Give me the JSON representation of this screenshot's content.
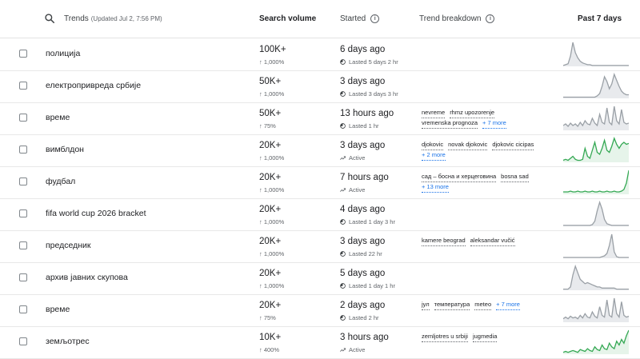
{
  "header": {
    "trends_label": "Trends",
    "updated": "(Updated Jul 2, 7:56 PM)",
    "volume": "Search volume",
    "started": "Started",
    "breakdown": "Trend breakdown",
    "past": "Past 7 days"
  },
  "colors": {
    "gray_line": "#9aa0a6",
    "gray_fill": "#e8eaed",
    "green_line": "#34a853",
    "green_fill": "#e6f4ea",
    "link": "#1a73e8"
  },
  "rows": [
    {
      "title": "полиција",
      "volume": "100K+",
      "pct": "↑ 1,000%",
      "ago": "6 days ago",
      "status": "Lasted 5 days 2 hr",
      "active": false,
      "chips": [],
      "more": "",
      "series": [
        1,
        2,
        3,
        12,
        28,
        16,
        10,
        6,
        4,
        3,
        2,
        2,
        1,
        1,
        1,
        1,
        1,
        1,
        1,
        1,
        1,
        1,
        1,
        1,
        1,
        1,
        1,
        1
      ],
      "green": false
    },
    {
      "title": "електропривреда србије",
      "volume": "50K+",
      "pct": "↑ 1,000%",
      "ago": "3 days ago",
      "status": "Lasted 3 days 3 hr",
      "active": false,
      "chips": [],
      "more": "",
      "series": [
        1,
        1,
        1,
        1,
        1,
        1,
        1,
        1,
        1,
        1,
        1,
        1,
        1,
        1,
        2,
        4,
        10,
        18,
        14,
        8,
        12,
        20,
        15,
        10,
        6,
        4,
        3,
        3
      ],
      "green": false
    },
    {
      "title": "време",
      "volume": "50K+",
      "pct": "↑ 75%",
      "ago": "13 hours ago",
      "status": "Lasted 1 hr",
      "active": false,
      "chips": [
        "nevreme",
        "rhmz upozorenje",
        "vremenska prognoza"
      ],
      "more": "+ 7 more",
      "series": [
        6,
        8,
        5,
        9,
        6,
        8,
        5,
        10,
        6,
        12,
        8,
        7,
        15,
        9,
        6,
        20,
        10,
        8,
        28,
        10,
        7,
        30,
        12,
        8,
        26,
        10,
        8,
        9
      ],
      "green": false
    },
    {
      "title": "вимблдон",
      "volume": "20K+",
      "pct": "↑ 1,000%",
      "ago": "3 days ago",
      "status": "Active",
      "active": true,
      "chips": [
        "djokovic",
        "novak djokovic",
        "djokovic cicipas"
      ],
      "more": "+ 2 more",
      "series": [
        2,
        3,
        2,
        4,
        6,
        3,
        2,
        2,
        3,
        14,
        6,
        4,
        12,
        20,
        10,
        8,
        14,
        22,
        12,
        10,
        16,
        24,
        18,
        14,
        18,
        20,
        18,
        19
      ],
      "green": true
    },
    {
      "title": "фудбал",
      "volume": "20K+",
      "pct": "↑ 1,000%",
      "ago": "7 hours ago",
      "status": "Active",
      "active": true,
      "chips": [
        "сад – босна и херцеговина",
        "bosna sad"
      ],
      "more": "+ 13 more",
      "series": [
        3,
        3,
        3,
        4,
        3,
        3,
        4,
        3,
        3,
        4,
        3,
        3,
        4,
        3,
        3,
        4,
        3,
        3,
        4,
        3,
        3,
        4,
        3,
        3,
        4,
        6,
        14,
        30
      ],
      "green": true
    },
    {
      "title": "fifa world cup 2026 bracket",
      "volume": "20K+",
      "pct": "↑ 1,000%",
      "ago": "4 days ago",
      "status": "Lasted 1 day 3 hr",
      "active": false,
      "chips": [],
      "more": "",
      "series": [
        1,
        1,
        1,
        1,
        1,
        1,
        1,
        1,
        1,
        1,
        1,
        1,
        2,
        6,
        18,
        28,
        20,
        8,
        3,
        2,
        1,
        1,
        1,
        1,
        1,
        1,
        1,
        1
      ],
      "green": false
    },
    {
      "title": "председник",
      "volume": "20K+",
      "pct": "↑ 1,000%",
      "ago": "3 days ago",
      "status": "Lasted 22 hr",
      "active": false,
      "chips": [
        "kamere beograd",
        "aleksandar vučić"
      ],
      "more": "",
      "series": [
        1,
        1,
        1,
        1,
        1,
        1,
        1,
        1,
        1,
        1,
        1,
        1,
        1,
        1,
        1,
        1,
        2,
        3,
        6,
        16,
        30,
        8,
        2,
        1,
        1,
        1,
        1,
        1
      ],
      "green": false
    },
    {
      "title": "архив јавних скупова",
      "volume": "20K+",
      "pct": "↑ 1,000%",
      "ago": "5 days ago",
      "status": "Lasted 1 day 1 hr",
      "active": false,
      "chips": [],
      "more": "",
      "series": [
        1,
        1,
        1,
        3,
        14,
        22,
        16,
        10,
        8,
        6,
        7,
        6,
        5,
        4,
        3,
        3,
        2,
        2,
        2,
        2,
        2,
        2,
        1,
        1,
        1,
        1,
        1,
        1
      ],
      "green": false
    },
    {
      "title": "време",
      "volume": "20K+",
      "pct": "↑ 75%",
      "ago": "2 days ago",
      "status": "Lasted 2 hr",
      "active": false,
      "chips": [
        "јул",
        "температура",
        "meteo"
      ],
      "more": "+ 7 more",
      "series": [
        4,
        6,
        4,
        7,
        5,
        6,
        4,
        8,
        5,
        10,
        6,
        5,
        12,
        7,
        5,
        18,
        8,
        6,
        26,
        8,
        6,
        28,
        10,
        6,
        24,
        8,
        6,
        7
      ],
      "green": false
    },
    {
      "title": "земљотрес",
      "volume": "10K+",
      "pct": "↑ 400%",
      "ago": "3 hours ago",
      "status": "Active",
      "active": true,
      "chips": [
        "zemljotres u srbiji",
        "jugmedia"
      ],
      "more": "",
      "series": [
        2,
        3,
        2,
        3,
        4,
        3,
        2,
        5,
        4,
        3,
        6,
        4,
        3,
        8,
        5,
        4,
        10,
        6,
        5,
        12,
        8,
        6,
        14,
        10,
        16,
        12,
        20,
        26
      ],
      "green": true
    }
  ]
}
